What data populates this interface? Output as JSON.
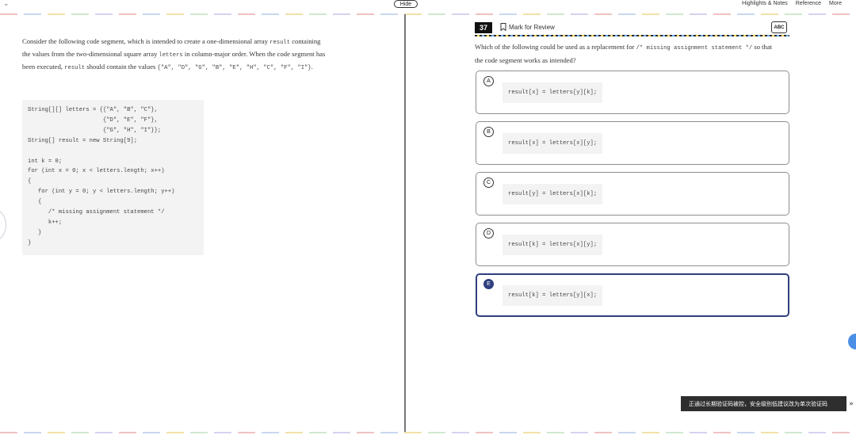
{
  "topbar": {
    "collapse_icon": "chevron-down-icon",
    "hide_label": "Hide",
    "tools": [
      "Highlights & Notes",
      "Reference",
      "More"
    ]
  },
  "passage": {
    "p1": "Consider the following code segment, which is intended to create a one-dimensional array",
    "c_result": "result",
    "p2": "containing the values from the two-dimensional square array",
    "c_letters": "letters",
    "p3": "in column-major order. When the code segment has been executed,",
    "c_result2": "result",
    "p4": "should contain the values",
    "c_values": "{\"A\", \"D\", \"G\", \"B\", \"E\", \"H\", \"C\", \"F\", \"I\"}",
    "p5": ".",
    "code": "String[][] letters = {{\"A\", \"B\", \"C\"},\n                      {\"D\", \"E\", \"F\"},\n                      {\"G\", \"H\", \"I\"}};\nString[] result = new String[9];\n\nint k = 0;\nfor (int x = 0; x < letters.length; x++)\n{\n   for (int y = 0; y < letters.length; y++)\n   {\n      /* missing assignment statement */\n      k++;\n   }\n}"
  },
  "question": {
    "number": "37",
    "mark_label": "Mark for Review",
    "abc_label": "ABC",
    "text1": "Which of the following could be used as a replacement for",
    "code": "/* missing assignment statement */",
    "text2": "so that the code segment works as intended?",
    "choices": [
      {
        "letter": "A",
        "code": "result[x] = letters[y][k];"
      },
      {
        "letter": "B",
        "code": "result[x] = letters[x][y];"
      },
      {
        "letter": "C",
        "code": "result[y] = letters[x][k];"
      },
      {
        "letter": "D",
        "code": "result[k] = letters[x][y];"
      },
      {
        "letter": "E",
        "code": "result[k] = letters[y][x];"
      }
    ],
    "selected": "E"
  },
  "toast": {
    "text": "正通过长期验证码被控，安全级别低建议改为单次验证码",
    "arrow": "»"
  },
  "colors": {
    "selected_border": "#2f3f7f",
    "code_bg": "#f3f3f3",
    "toast_bg": "#2e2e2e",
    "helper_dot": "#4a8ee6"
  }
}
